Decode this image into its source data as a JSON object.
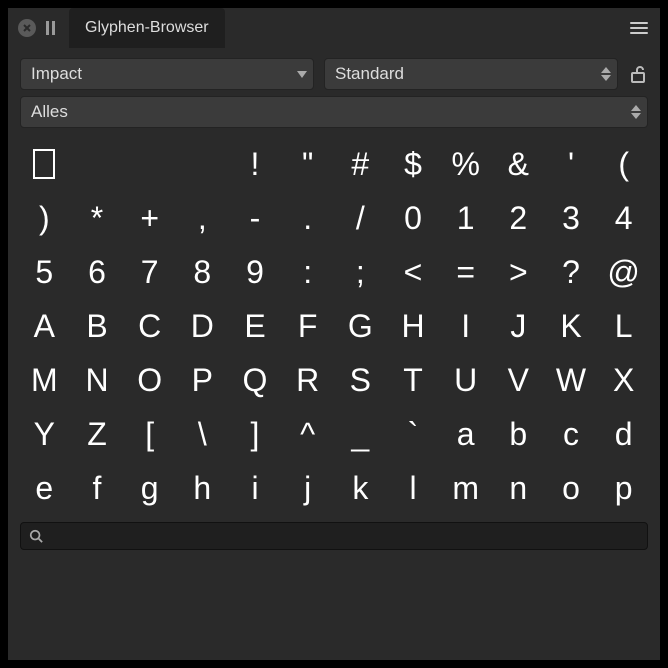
{
  "title": "Glyphen-Browser",
  "font_dropdown": {
    "value": "Impact"
  },
  "style_dropdown": {
    "value": "Standard"
  },
  "filter_dropdown": {
    "value": "Alles"
  },
  "search": {
    "value": "",
    "placeholder": ""
  },
  "glyphs": [
    "□",
    "",
    "",
    "",
    "!",
    "\"",
    "#",
    "$",
    "%",
    "&",
    "'",
    "(",
    ")",
    "*",
    "+",
    ",",
    "-",
    ".",
    "/",
    "0",
    "1",
    "2",
    "3",
    "4",
    "5",
    "6",
    "7",
    "8",
    "9",
    ":",
    ";",
    "<",
    "=",
    ">",
    "?",
    "@",
    "A",
    "B",
    "C",
    "D",
    "E",
    "F",
    "G",
    "H",
    "I",
    "J",
    "K",
    "L",
    "M",
    "N",
    "O",
    "P",
    "Q",
    "R",
    "S",
    "T",
    "U",
    "V",
    "W",
    "X",
    "Y",
    "Z",
    "[",
    "\\",
    "]",
    "^",
    "_",
    "`",
    "a",
    "b",
    "c",
    "d",
    "e",
    "f",
    "g",
    "h",
    "i",
    "j",
    "k",
    "l",
    "m",
    "n",
    "o",
    "p"
  ]
}
